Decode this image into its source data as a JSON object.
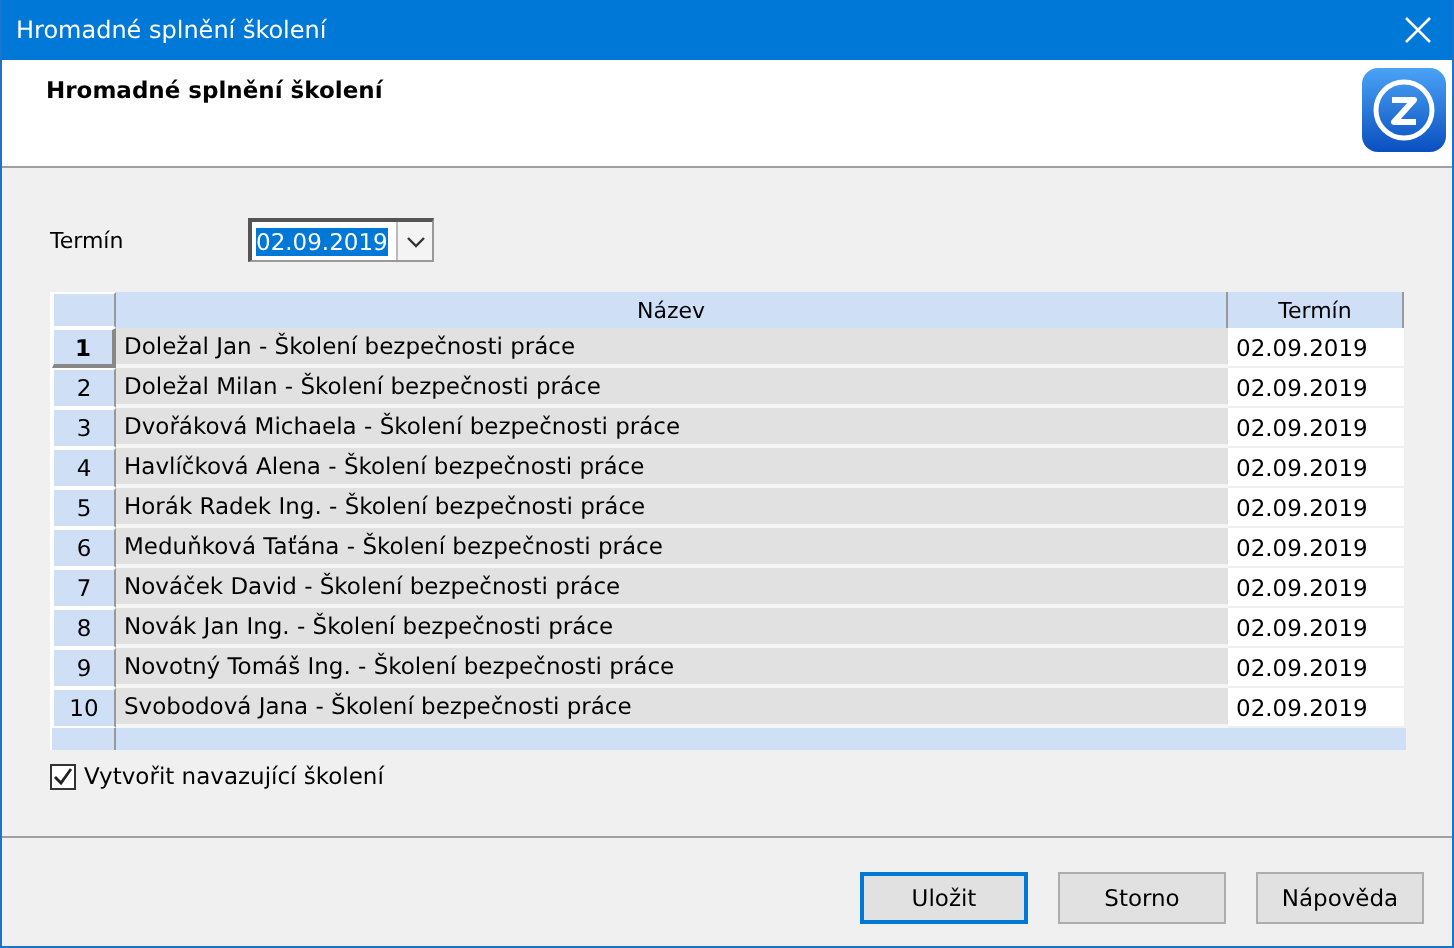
{
  "window": {
    "title": "Hromadné splnění školení"
  },
  "header": {
    "title": "Hromadné splnění školení"
  },
  "term_field": {
    "label": "Termín",
    "value": "02.09.2019"
  },
  "table": {
    "columns": [
      "Název",
      "Termín"
    ],
    "rows": [
      {
        "number": "1",
        "name": "Doležal Jan - Školení bezpečnosti práce",
        "term": "02.09.2019",
        "selected": true
      },
      {
        "number": "2",
        "name": "Doležal Milan - Školení bezpečnosti práce",
        "term": "02.09.2019",
        "selected": false
      },
      {
        "number": "3",
        "name": "Dvořáková Michaela - Školení bezpečnosti práce",
        "term": "02.09.2019",
        "selected": false
      },
      {
        "number": "4",
        "name": "Havlíčková Alena - Školení bezpečnosti práce",
        "term": "02.09.2019",
        "selected": false
      },
      {
        "number": "5",
        "name": "Horák Radek Ing. - Školení bezpečnosti práce",
        "term": "02.09.2019",
        "selected": false
      },
      {
        "number": "6",
        "name": "Meduňková Taťána - Školení bezpečnosti práce",
        "term": "02.09.2019",
        "selected": false
      },
      {
        "number": "7",
        "name": "Nováček David - Školení bezpečnosti práce",
        "term": "02.09.2019",
        "selected": false
      },
      {
        "number": "8",
        "name": "Novák Jan Ing. - Školení bezpečnosti práce",
        "term": "02.09.2019",
        "selected": false
      },
      {
        "number": "9",
        "name": "Novotný Tomáš Ing. - Školení bezpečnosti práce",
        "term": "02.09.2019",
        "selected": false
      },
      {
        "number": "10",
        "name": "Svobodová Jana - Školení bezpečnosti práce",
        "term": "02.09.2019",
        "selected": false
      }
    ]
  },
  "follow_up": {
    "label": "Vytvořit navazující školení",
    "checked": true
  },
  "buttons": [
    {
      "label": "Uložit",
      "default": true
    },
    {
      "label": "Storno",
      "default": false
    },
    {
      "label": "Nápověda",
      "default": false
    }
  ]
}
